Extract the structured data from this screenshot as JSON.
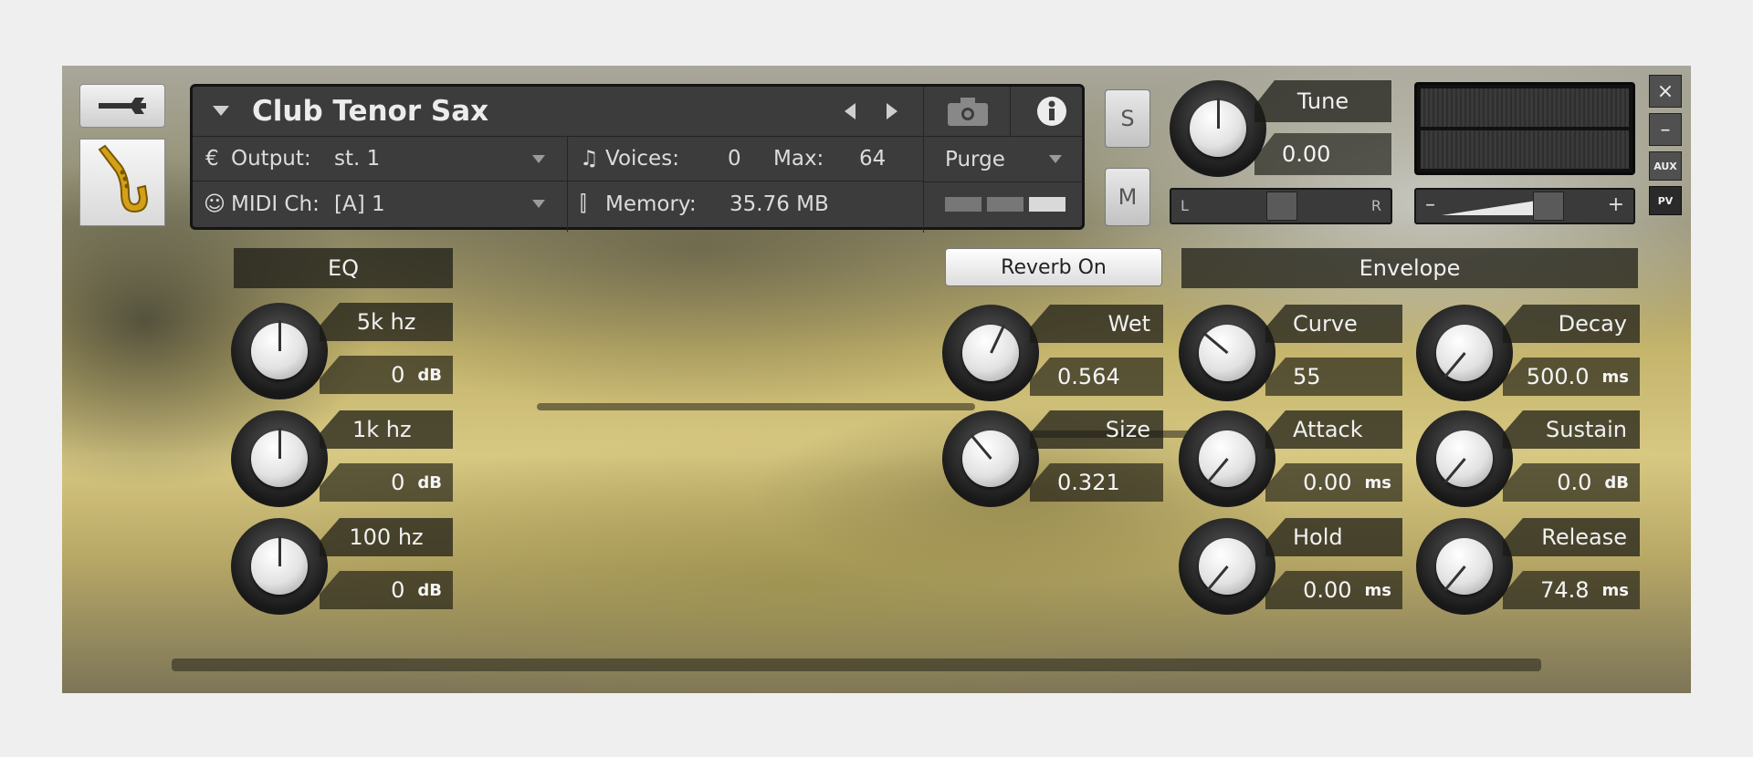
{
  "instrument": {
    "name": "Club Tenor Sax",
    "output_label": "Output:",
    "output_value": "st. 1",
    "midi_label": "MIDI Ch:",
    "midi_value": "[A]  1",
    "voices_label": "Voices:",
    "voices_value": "0",
    "max_label": "Max:",
    "max_value": "64",
    "memory_label": "Memory:",
    "memory_value": "35.76 MB",
    "purge_label": "Purge"
  },
  "side_buttons": {
    "solo": "S",
    "mute": "M"
  },
  "tune": {
    "label": "Tune",
    "value": "0.00"
  },
  "pan": {
    "left": "L",
    "right": "R"
  },
  "volume": {
    "minus": "–",
    "plus": "+"
  },
  "window_buttons": {
    "close": "×",
    "minimize": "–",
    "aux": "AUX",
    "pv": "PV"
  },
  "eq": {
    "title": "EQ",
    "bands": [
      {
        "label": "5k hz",
        "value": "0",
        "unit": "dB"
      },
      {
        "label": "1k hz",
        "value": "0",
        "unit": "dB"
      },
      {
        "label": "100 hz",
        "value": "0",
        "unit": "dB"
      }
    ]
  },
  "reverb": {
    "toggle_label": "Reverb On",
    "wet": {
      "label": "Wet",
      "value": "0.564"
    },
    "size": {
      "label": "Size",
      "value": "0.321"
    }
  },
  "envelope": {
    "title": "Envelope",
    "curve": {
      "label": "Curve",
      "value": "55"
    },
    "decay": {
      "label": "Decay",
      "value": "500.0",
      "unit": "ms"
    },
    "attack": {
      "label": "Attack",
      "value": "0.00",
      "unit": "ms"
    },
    "sustain": {
      "label": "Sustain",
      "value": "0.0",
      "unit": "dB"
    },
    "hold": {
      "label": "Hold",
      "value": "0.00",
      "unit": "ms"
    },
    "release": {
      "label": "Release",
      "value": "74.8",
      "unit": "ms"
    }
  }
}
